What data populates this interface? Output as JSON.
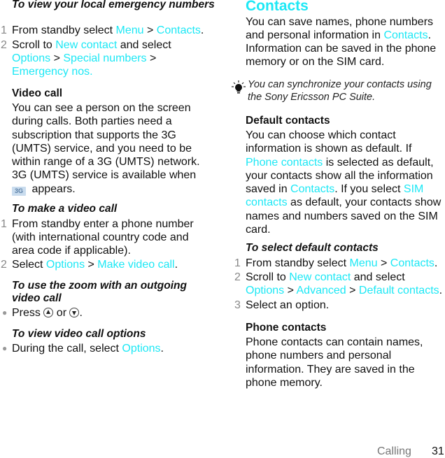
{
  "left": {
    "emergency": {
      "heading": "To view your local emergency numbers",
      "steps": [
        {
          "num": "1",
          "parts": [
            "From standby select ",
            "Menu",
            " > ",
            "Contacts",
            "."
          ]
        },
        {
          "num": "2",
          "parts": [
            "Scroll to ",
            "New contact",
            " and select ",
            "Options",
            " > ",
            "Special numbers",
            " > ",
            "Emergency nos."
          ]
        }
      ]
    },
    "video_call": {
      "heading": "Video call",
      "body": "You can see a person on the screen during calls. Both parties need a subscription that supports the 3G (UMTS) service, and you need to be within range of a 3G (UMTS) network. 3G (UMTS) service is available when",
      "icon_label": "3G",
      "body_end": " appears."
    },
    "make_video_call": {
      "heading": "To make a video call",
      "steps": [
        {
          "num": "1",
          "text": "From standby enter a phone number (with international country code and area code if applicable)."
        },
        {
          "num": "2",
          "parts": [
            "Select ",
            "Options",
            " > ",
            "Make video call",
            "."
          ]
        }
      ]
    },
    "zoom": {
      "heading": "To use the zoom with an outgoing video call",
      "bullet": {
        "pre": "Press ",
        "mid": " or ",
        "post": "."
      }
    },
    "options": {
      "heading": "To view video call options",
      "bullet": [
        "During the call, select ",
        "Options",
        "."
      ]
    }
  },
  "right": {
    "title": "Contacts",
    "intro": [
      "You can save names, phone numbers and personal information in ",
      "Contacts",
      ". Information can be saved in the phone memory or on the SIM card."
    ],
    "tip": "You can synchronize your contacts using the Sony Ericsson PC Suite.",
    "default_contacts": {
      "heading": "Default contacts",
      "body": [
        "You can choose which contact information is shown as default. If ",
        "Phone contacts",
        " is selected as default, your contacts show all the information saved in ",
        "Contacts",
        ". If you select ",
        "SIM contacts",
        " as default, your contacts show names and numbers saved on the SIM card."
      ]
    },
    "select_default": {
      "heading": "To select default contacts",
      "steps": [
        {
          "num": "1",
          "parts": [
            "From standby select ",
            "Menu",
            " > ",
            "Contacts",
            "."
          ]
        },
        {
          "num": "2",
          "parts": [
            "Scroll to ",
            "New contact",
            " and select ",
            "Options",
            " > ",
            "Advanced",
            " > ",
            "Default contacts",
            "."
          ]
        },
        {
          "num": "3",
          "text": "Select an option."
        }
      ]
    },
    "phone_contacts": {
      "heading": "Phone contacts",
      "body": "Phone contacts can contain names, phone numbers and personal information. They are saved in the phone memory."
    }
  },
  "footer": {
    "section": "Calling",
    "page": "31"
  },
  "colors": {
    "link": "#1de8f5",
    "step_number": "#888888"
  }
}
